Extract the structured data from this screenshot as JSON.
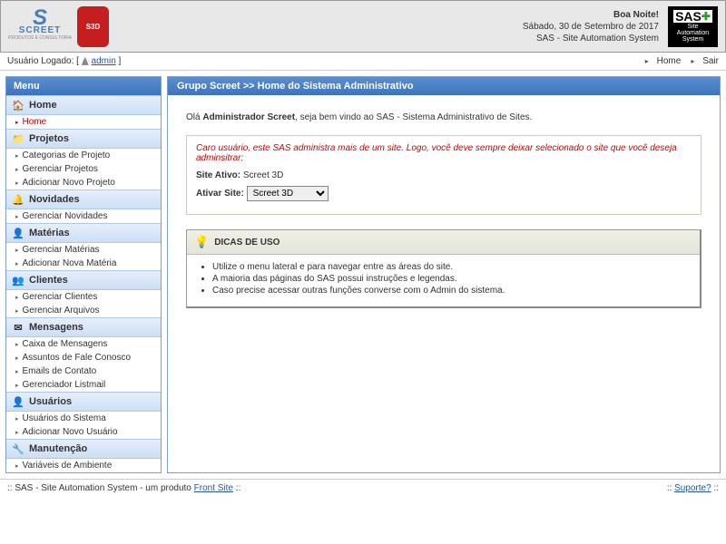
{
  "header": {
    "logo_text": "SCREET",
    "logo_sub": "PRODUTOS E CONSULTORIA",
    "badge_text": "S3D",
    "greeting": "Boa Noite!",
    "date_line": "Sábado, 30 de Setembro de 2017",
    "system_line": "SAS - Site Automation System",
    "sas_logo_big": "SAS",
    "sas_logo_l1": "Site",
    "sas_logo_l2": "Automation",
    "sas_logo_l3": "System"
  },
  "topbar": {
    "logged_label": "Usuário Logado: [",
    "logged_user": "admin",
    "logged_close": " ]",
    "home": "Home",
    "exit": "Sair"
  },
  "sidebar": {
    "menu_title": "Menu",
    "sections": [
      {
        "label": "Home",
        "icon": "🏠",
        "items": [
          {
            "label": "Home",
            "active": true
          }
        ]
      },
      {
        "label": "Projetos",
        "icon": "📁",
        "items": [
          {
            "label": "Categorias de Projeto"
          },
          {
            "label": "Gerenciar Projetos"
          },
          {
            "label": "Adicionar Novo Projeto"
          }
        ]
      },
      {
        "label": "Novidades",
        "icon": "🔔",
        "items": [
          {
            "label": "Gerenciar Novidades"
          }
        ]
      },
      {
        "label": "Matérias",
        "icon": "👤",
        "items": [
          {
            "label": "Gerenciar Matérias"
          },
          {
            "label": "Adicionar Nova Matéria"
          }
        ]
      },
      {
        "label": "Clientes",
        "icon": "👥",
        "items": [
          {
            "label": "Gerenciar Clientes"
          },
          {
            "label": "Gerenciar Arquivos"
          }
        ]
      },
      {
        "label": "Mensagens",
        "icon": "✉",
        "items": [
          {
            "label": "Caixa de Mensagens"
          },
          {
            "label": "Assuntos de Fale Conosco"
          },
          {
            "label": "Emails de Contato"
          },
          {
            "label": "Gerenciador Listmail"
          }
        ]
      },
      {
        "label": "Usuários",
        "icon": "👤",
        "items": [
          {
            "label": "Usuários do Sistema"
          },
          {
            "label": "Adicionar Novo Usuário"
          }
        ]
      },
      {
        "label": "Manutenção",
        "icon": "🔧",
        "items": [
          {
            "label": "Variáveis de Ambiente"
          }
        ]
      }
    ]
  },
  "main": {
    "breadcrumb": "Grupo Screet >> Home do Sistema Administrativo",
    "hello_prefix": "Olá ",
    "hello_bold": "Administrador Screet",
    "hello_suffix": ", seja bem vindo ao SAS - Sistema Administrativo de Sites.",
    "warn_text": "Caro usuário, este SAS administra mais de um site. Logo, você deve sempre deixar selecionado o site que você deseja adminsitrar:",
    "site_active_label": "Site Ativo:",
    "site_active_value": "Screet 3D",
    "activate_label": "Ativar Site:",
    "activate_selected": "Screet 3D",
    "tips_title": "DICAS DE USO",
    "tips": [
      "Utilize o menu lateral e para navegar entre as áreas do site.",
      "A maioria das páginas do SAS possui instruções e legendas.",
      "Caso precise acessar outras funções converse com o Admin do sistema."
    ]
  },
  "footer": {
    "left_prefix": ":: SAS - Site Automation System - um produto ",
    "left_link": "Front Site",
    "left_suffix": " ::",
    "right_prefix": ":: ",
    "right_link": "Suporte?",
    "right_suffix": " ::"
  }
}
